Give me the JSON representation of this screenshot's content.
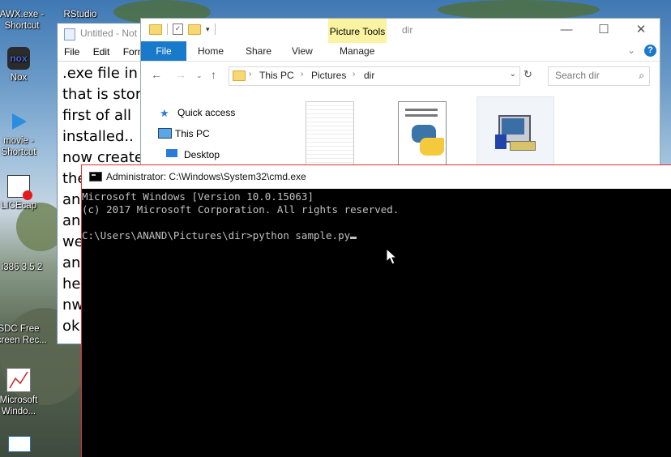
{
  "desktop": {
    "icons": [
      {
        "label": "AWX.exe -\nShortcut"
      },
      {
        "label": "RStudio"
      },
      {
        "label": "Nox"
      },
      {
        "label": "movie -\nShortcut"
      },
      {
        "label": "LICEcap"
      },
      {
        "label": "i386 3.5.2"
      },
      {
        "label": "SDC Free\nScreen Rec..."
      },
      {
        "label": "Microsoft\nWindo..."
      }
    ]
  },
  "notepad": {
    "title": "Untitled - Not",
    "menu": [
      "File",
      "Edit",
      "Forma"
    ],
    "lines": [
      ".exe file in c",
      "that is stor",
      "first of all",
      "installed..",
      "now create",
      "the",
      "and",
      "and",
      "we",
      "and",
      "her",
      "nw",
      "ok"
    ]
  },
  "explorer": {
    "context_tab": "Picture Tools",
    "window_name": "dir",
    "tabs": [
      "File",
      "Home",
      "Share",
      "View",
      "Manage"
    ],
    "breadcrumb": [
      "This PC",
      "Pictures",
      "dir"
    ],
    "search_placeholder": "Search dir",
    "nav": [
      {
        "label": "Quick access",
        "icon": "star-icon"
      },
      {
        "label": "This PC",
        "icon": "computer-icon"
      },
      {
        "label": "Desktop",
        "icon": "desktop-icon"
      }
    ],
    "files": [
      {
        "icon": "text-document-icon"
      },
      {
        "icon": "python-file-icon"
      },
      {
        "icon": "installer-icon"
      }
    ]
  },
  "cmd": {
    "title": "Administrator: C:\\Windows\\System32\\cmd.exe",
    "lines": [
      "Microsoft Windows [Version 10.0.15063]",
      "(c) 2017 Microsoft Corporation. All rights reserved.",
      "",
      "C:\\Users\\ANAND\\Pictures\\dir>python sample.py"
    ]
  },
  "colors": {
    "ribbon_accent": "#1979ca",
    "context_tab": "#fbf3a2",
    "console_bg": "#000000",
    "console_text": "#c0c0c0"
  }
}
